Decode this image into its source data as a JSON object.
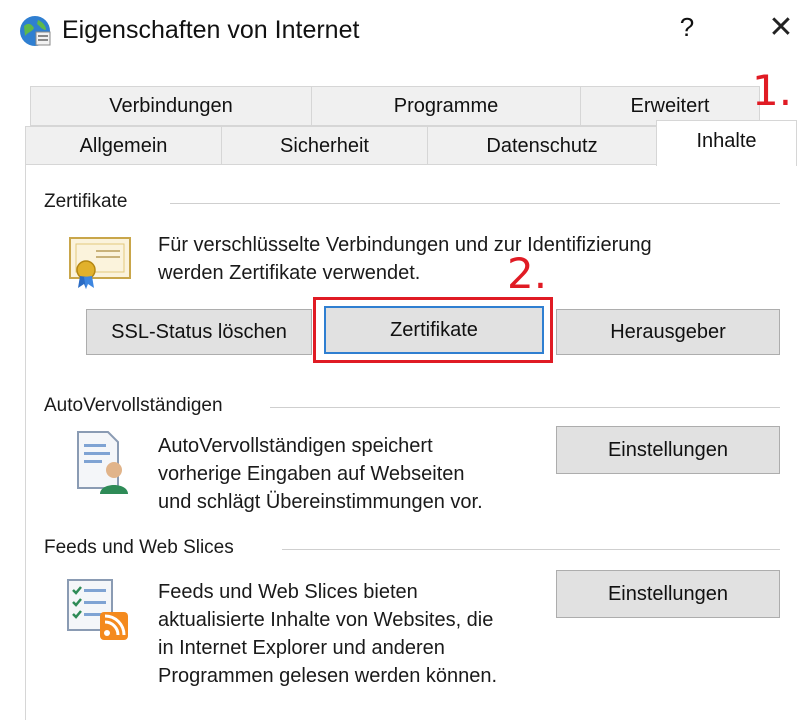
{
  "window": {
    "title": "Eigenschaften von Internet",
    "help_label": "?",
    "close_label": "✕",
    "icon": "internet-options-globe-icon"
  },
  "tabs": {
    "row1": [
      "Verbindungen",
      "Programme",
      "Erweitert"
    ],
    "row2": [
      "Allgemein",
      "Sicherheit",
      "Datenschutz",
      "Inhalte"
    ],
    "active": "Inhalte"
  },
  "certificates": {
    "label": "Zertifikate",
    "icon": "certificate-icon",
    "description_line1": "Für verschlüsselte Verbindungen und zur Identifizierung",
    "description_line2": "werden Zertifikate verwendet.",
    "buttons": {
      "clear_ssl": "SSL-Status löschen",
      "certificates": "Zertifikate",
      "publishers": "Herausgeber"
    }
  },
  "autocomplete": {
    "label": "AutoVervollständigen",
    "icon": "autocomplete-user-icon",
    "description_line1": "AutoVervollständigen speichert",
    "description_line2": "vorherige Eingaben auf Webseiten",
    "description_line3": "und schlägt Übereinstimmungen vor.",
    "settings_button": "Einstellungen"
  },
  "feeds": {
    "label": "Feeds und Web Slices",
    "icon": "feeds-rss-icon",
    "description_line1": "Feeds und Web Slices bieten",
    "description_line2": "aktualisierte Inhalte von Websites, die",
    "description_line3": "in Internet Explorer und anderen",
    "description_line4": "Programmen gelesen werden können.",
    "settings_button": "Einstellungen"
  },
  "annotations": {
    "step1": "1.",
    "step2": "2.",
    "color": "#e01b24"
  }
}
